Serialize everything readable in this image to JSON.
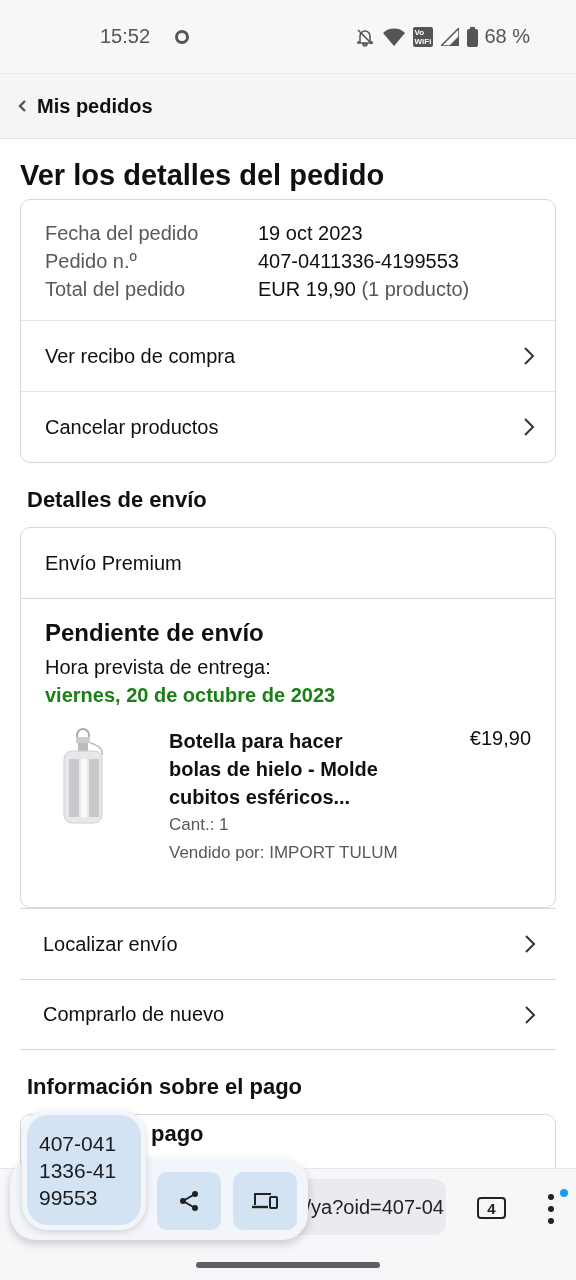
{
  "status_bar": {
    "time": "15:52",
    "vowifi": [
      "Vo",
      "WiFi"
    ],
    "battery": "68 %"
  },
  "nav": {
    "back_label": "Mis pedidos"
  },
  "title": "Ver los detalles del pedido",
  "order_summary": {
    "fields": [
      {
        "label": "Fecha del pedido",
        "value": "19 oct 2023"
      },
      {
        "label": "Pedido n.º",
        "value": "407-0411336-4199553"
      },
      {
        "label": "Total del pedido",
        "value": "EUR 19,90",
        "note": "(1 producto)"
      }
    ],
    "links": [
      "Ver recibo de compra",
      "Cancelar productos"
    ]
  },
  "shipping": {
    "heading": "Detalles de envío",
    "method": "Envío Premium",
    "status": "Pendiente de envío",
    "delivery_label": "Hora prevista de entrega:",
    "delivery_date": "viernes, 20 de octubre de 2023",
    "item": {
      "kind": "picture",
      "title": "Botella para hacer bolas de hielo - Molde cubitos esféricos...",
      "price": "€19,90",
      "quantity": "Cant.: 1",
      "seller": "Vendido por: IMPORT TULUM"
    },
    "links": [
      "Localizar envío",
      "Comprarlo de nuevo"
    ]
  },
  "payment": {
    "heading": "Información sobre el pago",
    "card_title": "pago"
  },
  "browser": {
    "url": "/ya?oid=407-04",
    "tab_count": "4",
    "menu_notification": true
  },
  "share_popup": {
    "copied_text": "407-0411336-4199553"
  }
}
